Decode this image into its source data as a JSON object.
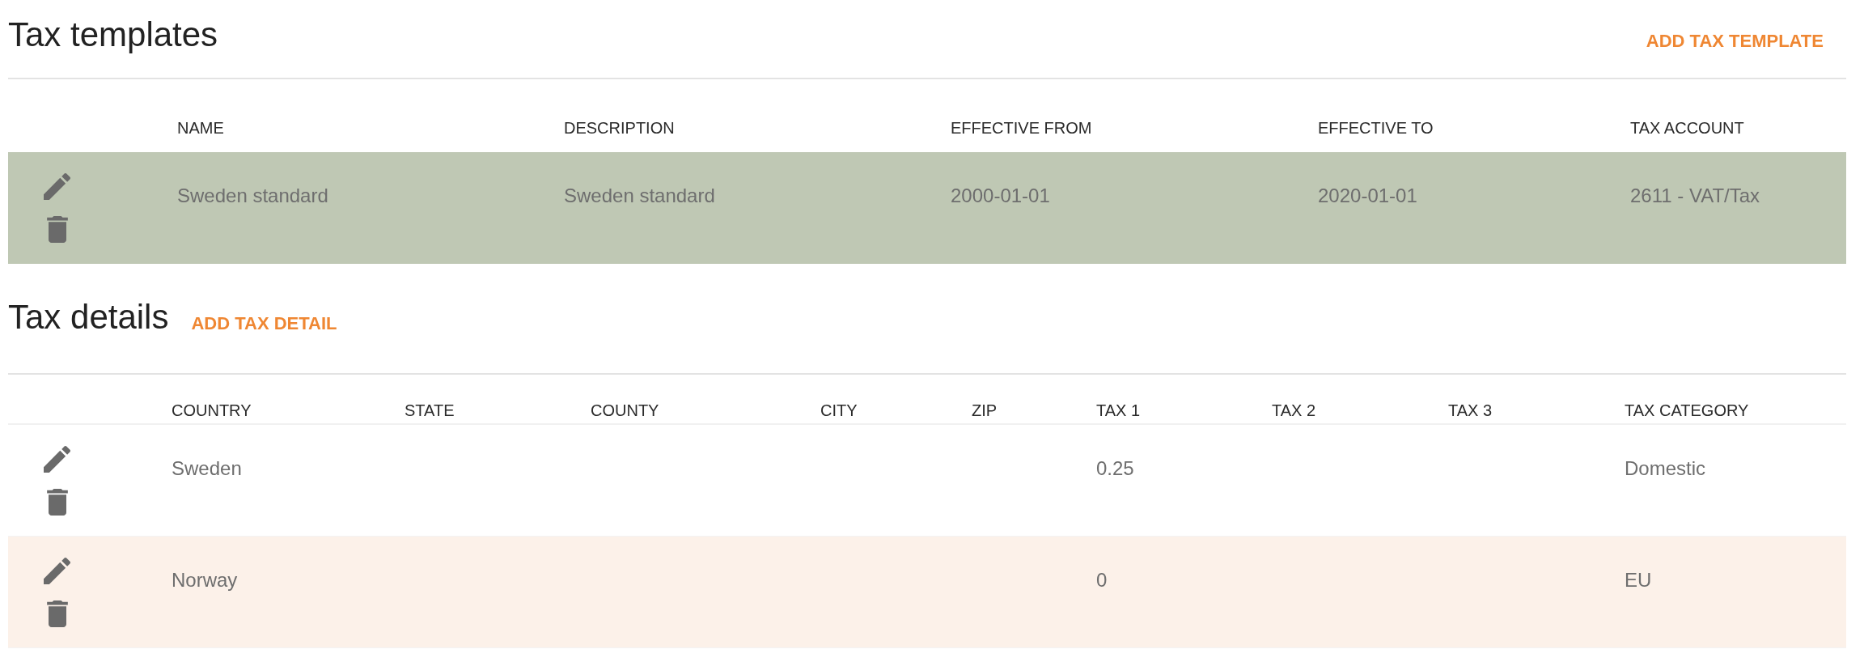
{
  "templates": {
    "title": "Tax templates",
    "add_button": "ADD TAX TEMPLATE",
    "columns": [
      "NAME",
      "DESCRIPTION",
      "EFFECTIVE FROM",
      "EFFECTIVE TO",
      "TAX ACCOUNT"
    ],
    "rows": [
      {
        "selected": true,
        "name": "Sweden standard",
        "description": "Sweden standard",
        "effective_from": "2000-01-01",
        "effective_to": "2020-01-01",
        "tax_account": "2611 - VAT/Tax"
      }
    ]
  },
  "details": {
    "title": "Tax details",
    "add_button": "ADD TAX DETAIL",
    "columns": [
      "COUNTRY",
      "STATE",
      "COUNTY",
      "CITY",
      "ZIP",
      "TAX 1",
      "TAX 2",
      "TAX 3",
      "TAX CATEGORY"
    ],
    "rows": [
      {
        "highlighted": false,
        "country": "Sweden",
        "tax_1": "0.25",
        "tax_category": "Domestic"
      },
      {
        "highlighted": true,
        "country": "Norway",
        "tax_1": "0",
        "tax_category": "EU"
      }
    ]
  }
}
